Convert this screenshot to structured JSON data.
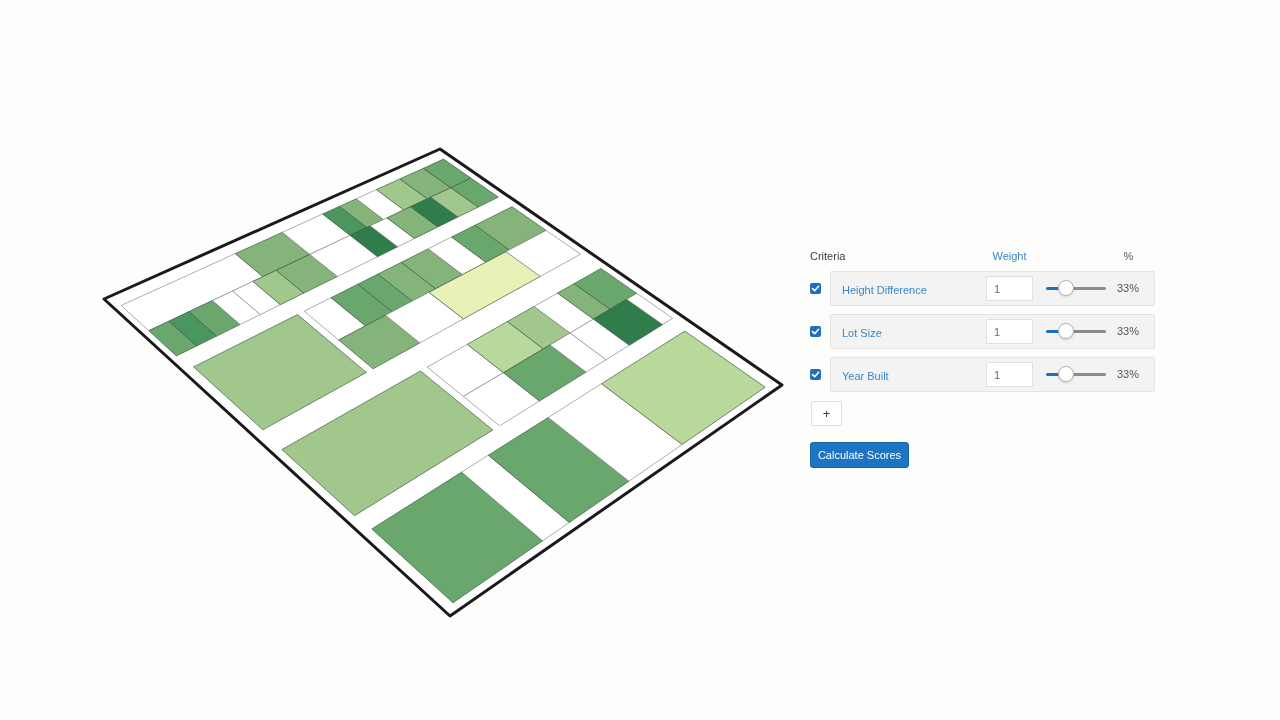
{
  "criteria_panel": {
    "headers": {
      "criteria": "Criteria",
      "weight": "Weight",
      "percent": "%"
    },
    "rows": [
      {
        "checked": true,
        "label": "Height Difference",
        "weight": "1",
        "level": 0.33,
        "reading": "33%"
      },
      {
        "checked": true,
        "label": "Lot Size",
        "weight": "1",
        "level": 0.33,
        "reading": "33%"
      },
      {
        "checked": true,
        "label": "Year Built",
        "weight": "1",
        "level": 0.33,
        "reading": "33%"
      }
    ],
    "add_button": "+",
    "calculate_button": "Calculate Scores"
  }
}
